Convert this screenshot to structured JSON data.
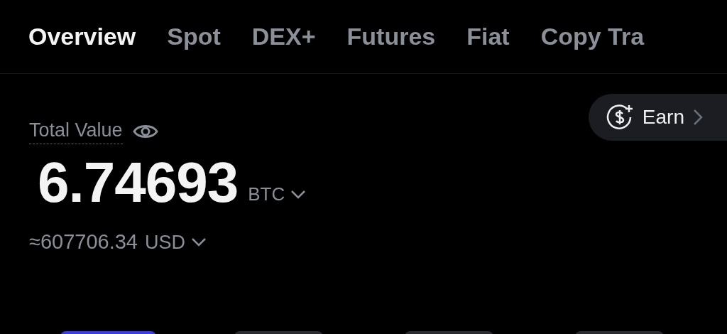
{
  "tabs": [
    {
      "label": "Overview",
      "selected": true
    },
    {
      "label": "Spot",
      "selected": false
    },
    {
      "label": "DEX+",
      "selected": false
    },
    {
      "label": "Futures",
      "selected": false
    },
    {
      "label": "Fiat",
      "selected": false
    },
    {
      "label": "Copy Tra",
      "selected": false
    }
  ],
  "total_value": {
    "label": "Total Value",
    "balance": "6.74693",
    "unit": "BTC",
    "fiat_value": "≈607706.34",
    "fiat_unit": "USD"
  },
  "earn_button": {
    "label": "Earn"
  }
}
